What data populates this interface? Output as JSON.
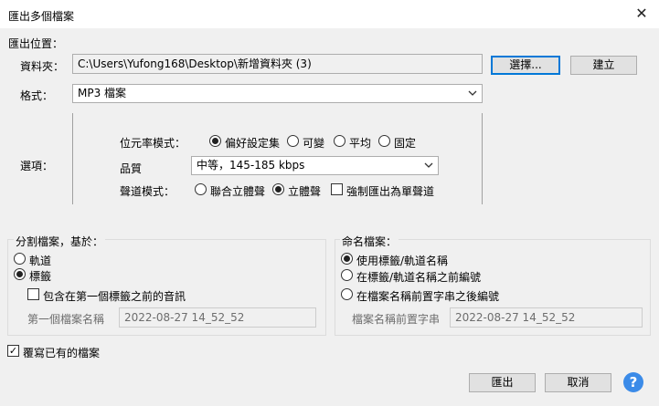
{
  "window": {
    "title": "匯出多個檔案",
    "close_glyph": "✕"
  },
  "location": {
    "section_label": "匯出位置：",
    "folder_label": "資料夾：",
    "folder_value": "C:\\Users\\Yufong168\\Desktop\\新增資料夾 (3)",
    "choose_button": "選擇...",
    "create_button": "建立"
  },
  "format": {
    "label": "格式：",
    "selected": "MP3 檔案"
  },
  "options": {
    "label": "選項：",
    "bitrate_mode_label": "位元率模式：",
    "bitrate_modes": [
      "偏好設定集",
      "可變",
      "平均",
      "固定"
    ],
    "bitrate_selected_index": 0,
    "quality_label": "品質",
    "quality_selected": "中等，145-185 kbps",
    "channel_mode_label": "聲道模式：",
    "channel_modes": [
      "聯合立體聲",
      "立體聲"
    ],
    "channel_selected_index": 1,
    "force_mono_label": "強制匯出為單聲道",
    "force_mono_checked": false
  },
  "split": {
    "section_label": "分割檔案，基於：",
    "options": [
      "軌道",
      "標籤"
    ],
    "selected_index": 1,
    "include_before_label": "包含在第一個標籤之前的音訊",
    "include_before_checked": false,
    "first_file_label": "第一個檔案名稱",
    "first_file_value": "2022-08-27 14_52_52"
  },
  "naming": {
    "section_label": "命名檔案：",
    "options": [
      "使用標籤/軌道名稱",
      "在標籤/軌道名稱之前編號",
      "在檔案名稱前置字串之後編號"
    ],
    "selected_index": 0,
    "prefix_label": "檔案名稱前置字串",
    "prefix_value": "2022-08-27 14_52_52"
  },
  "overwrite": {
    "label": "覆寫已有的檔案",
    "checked": true,
    "check_glyph": "✓"
  },
  "footer": {
    "export_button": "匯出",
    "cancel_button": "取消",
    "help_glyph": "?"
  },
  "colors": {
    "accent": "#0078d7",
    "help": "#3b8be8"
  },
  "icons": {
    "close": "close-icon",
    "dropdown": "chevron-down-icon",
    "help": "help-icon"
  }
}
